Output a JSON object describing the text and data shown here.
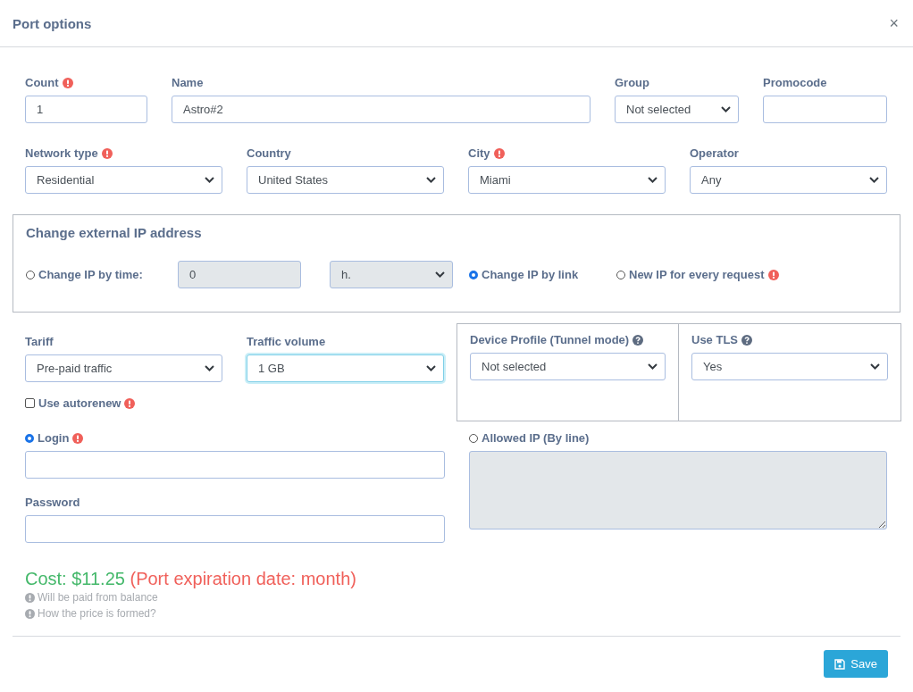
{
  "dialog": {
    "title": "Port options",
    "close": "×"
  },
  "general": [
    [
      {
        "label": "Count",
        "required": true,
        "help": false,
        "kind": "input",
        "value": "1"
      },
      {
        "label": "Name",
        "required": false,
        "help": false,
        "kind": "input",
        "value": "Astro#2"
      },
      {
        "label": "Group",
        "required": false,
        "help": false,
        "kind": "select",
        "value": "Not selected"
      },
      {
        "label": "Promocode",
        "required": false,
        "help": false,
        "kind": "input"
      }
    ],
    [
      {
        "label": "Network type",
        "required": true,
        "help": false,
        "kind": "select",
        "value": "Residential"
      },
      {
        "label": "Country",
        "required": false,
        "help": false,
        "kind": "select",
        "value": "United States"
      },
      {
        "label": "City",
        "required": true,
        "help": false,
        "kind": "select",
        "value": "Miami"
      },
      {
        "label": "Operator",
        "required": false,
        "help": false,
        "kind": "select",
        "value": "Any"
      }
    ]
  ],
  "ip_change": {
    "title": "Change external IP address",
    "options": [
      {
        "kind": "time",
        "label": "Change IP by time:",
        "selected": false,
        "required": false,
        "interval": {
          "value": "0",
          "disabled": true
        },
        "unit": {
          "value": "h.",
          "disabled": true
        }
      },
      {
        "kind": "plain",
        "label": "Change IP by link",
        "selected": true,
        "required": false
      },
      {
        "kind": "plain",
        "label": "New IP for every request",
        "selected": false,
        "required": true
      }
    ]
  },
  "tariff": {
    "fields": [
      {
        "label": "Tariff",
        "required": false,
        "help": false,
        "kind": "select",
        "value": "Pre-paid traffic",
        "focused": false
      },
      {
        "label": "Traffic volume",
        "required": false,
        "help": false,
        "kind": "select",
        "value": "1 GB",
        "focused": true
      },
      {
        "label": "Device Profile (Tunnel mode)",
        "required": false,
        "help": true,
        "kind": "select",
        "value": "Not selected",
        "focused": false
      },
      {
        "label": "Use TLS",
        "required": false,
        "help": true,
        "kind": "select",
        "value": "Yes",
        "focused": false
      }
    ],
    "autorenew": {
      "label": "Use autorenew",
      "checked": false,
      "required": true
    }
  },
  "auth": {
    "login": {
      "label": "Login",
      "selected": true,
      "required": true
    },
    "password_label": "Password",
    "allowed_ip": {
      "label": "Allowed IP (By line)",
      "selected": false,
      "disabled": true
    }
  },
  "cost": {
    "price": "Cost: $11.25",
    "expiration": "(Port expiration date: month)",
    "notes": [
      "Will be paid from balance",
      "How the price is formed?"
    ]
  },
  "footer": {
    "save": "Save"
  }
}
